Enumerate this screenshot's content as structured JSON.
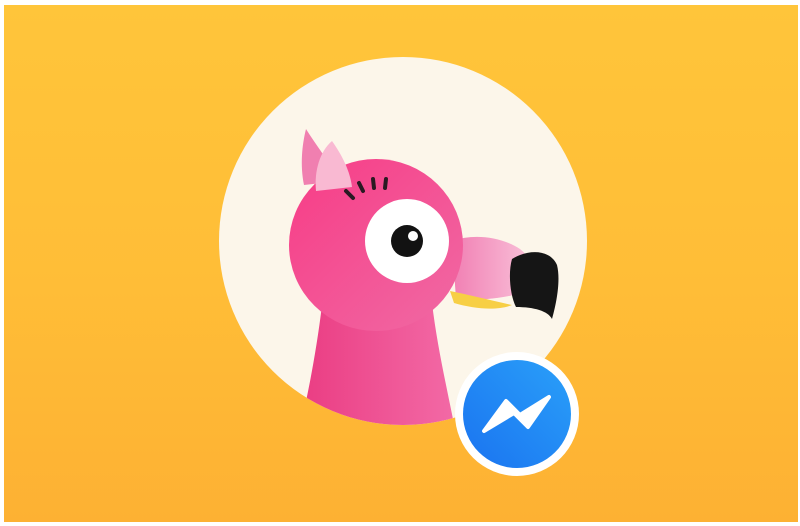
{
  "banner": {
    "background_color": "#ffbd37",
    "avatar_bg_color": "#fcf6ea",
    "mascot": "flamingo",
    "mascot_color": "#f24d8e",
    "badge_icon": "messenger-icon",
    "badge_color": "#1e88f5"
  }
}
